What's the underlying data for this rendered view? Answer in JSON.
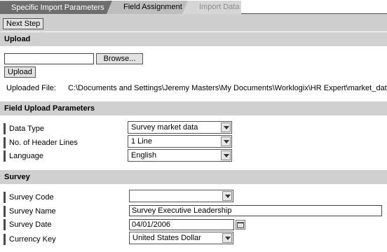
{
  "tabs": [
    {
      "label": "Specific Import Parameters",
      "state": "active"
    },
    {
      "label": "Field Assignment",
      "state": "inactive"
    },
    {
      "label": "Import Data",
      "state": "disabled"
    }
  ],
  "toolbar": {
    "next_step_label": "Next Step"
  },
  "upload": {
    "header": "Upload",
    "file_value": "",
    "browse_label": "Browse...",
    "upload_label": "Upload",
    "uploaded_file_label": "Uploaded File:",
    "uploaded_file_path": "C:\\Documents and Settings\\Jeremy Masters\\My Documents\\Worklogix\\HR Expert\\market_data.txt"
  },
  "field_upload": {
    "header": "Field Upload Parameters",
    "data_type": {
      "label": "Data Type",
      "value": "Survey market data"
    },
    "header_lines": {
      "label": "No. of Header Lines",
      "value": "1 Line"
    },
    "language": {
      "label": "Language",
      "value": "English"
    }
  },
  "survey": {
    "header": "Survey",
    "survey_code": {
      "label": "Survey Code",
      "value": ""
    },
    "survey_name": {
      "label": "Survey Name",
      "value": "Survey Executive Leadership"
    },
    "survey_date": {
      "label": "Survey Date",
      "value": "04/01/2006"
    },
    "currency_key": {
      "label": "Currency Key",
      "value": "United States Dollar"
    }
  },
  "colors": {
    "active_tab": "#6e6e6e",
    "inactive_tab": "#bdbdbd",
    "disabled_tab": "#d6d6d6",
    "section_header": "#d0d0d0",
    "toolbar": "#cfcfcf"
  },
  "icons": {
    "date_picker": "calendar-icon",
    "dropdown": "chevron-down-icon"
  }
}
